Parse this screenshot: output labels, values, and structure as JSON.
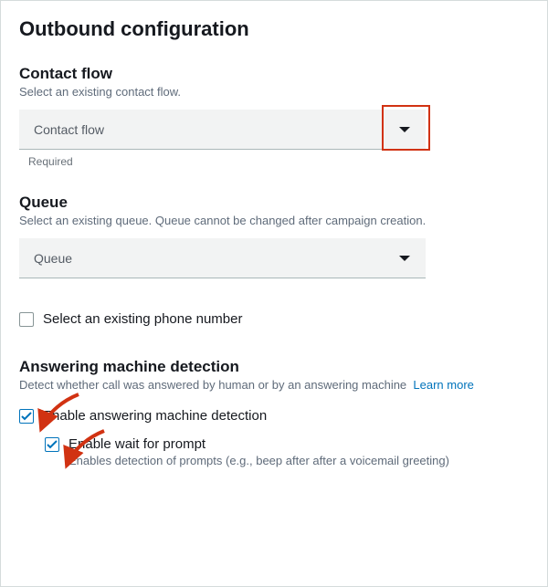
{
  "title": "Outbound configuration",
  "contact_flow": {
    "heading": "Contact flow",
    "helper": "Select an existing contact flow.",
    "placeholder": "Contact flow",
    "required_label": "Required"
  },
  "queue": {
    "heading": "Queue",
    "helper": "Select an existing queue. Queue cannot be changed after campaign creation.",
    "placeholder": "Queue"
  },
  "phone_checkbox": {
    "label": "Select an existing phone number",
    "checked": false
  },
  "amd": {
    "heading": "Answering machine detection",
    "helper": "Detect whether call was answered by human or by an answering machine",
    "learn_more": "Learn more",
    "enable": {
      "label": "Enable answering machine detection",
      "checked": true
    },
    "wait": {
      "label": "Enable wait for prompt",
      "desc": "Enables detection of prompts (e.g., beep after after a voicemail greeting)",
      "checked": true
    }
  }
}
